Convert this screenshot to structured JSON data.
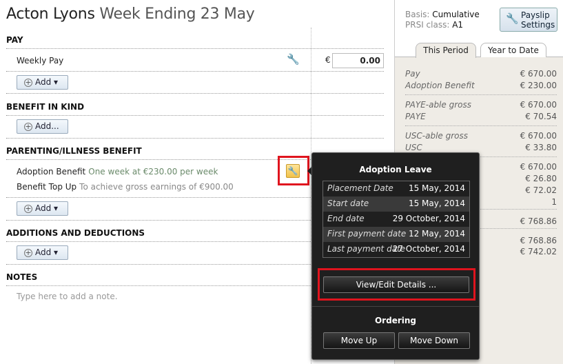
{
  "header": {
    "name": "Acton Lyons",
    "period": "Week Ending 23 May"
  },
  "pay": {
    "title": "PAY",
    "item": "Weekly Pay",
    "currency": "€",
    "value": "0.00",
    "add": "Add"
  },
  "bik": {
    "title": "BENEFIT IN KIND",
    "add": "Add..."
  },
  "parenting": {
    "title": "PARENTING/ILLNESS BENEFIT",
    "items": [
      {
        "label": "Adoption Benefit",
        "desc": "One week at €230.00 per week"
      },
      {
        "label": "Benefit Top Up",
        "desc": "To achieve gross earnings of €900.00"
      }
    ],
    "add": "Add"
  },
  "additions": {
    "title": "ADDITIONS AND DEDUCTIONS",
    "add": "Add"
  },
  "notes": {
    "title": "NOTES",
    "placeholder": "Type here to add a note."
  },
  "side": {
    "basis_label": "Basis:",
    "basis": "Cumulative",
    "prsi_label": "PRSI class:",
    "prsi": "A1",
    "settings": "Payslip Settings",
    "tabs": [
      {
        "label": "This Period",
        "active": true
      },
      {
        "label": "Year to Date",
        "active": false
      }
    ],
    "rows": [
      {
        "label": "Pay",
        "value": "€ 670.00"
      },
      {
        "label": "Adoption Benefit",
        "value": "€ 230.00"
      },
      {
        "label": "PAYE-able gross",
        "value": "€ 670.00"
      },
      {
        "label": "PAYE",
        "value": "€ 70.54"
      },
      {
        "label": "USC-able gross",
        "value": "€ 670.00"
      },
      {
        "label": "USC",
        "value": "€ 33.80"
      },
      {
        "value": "€ 670.00"
      },
      {
        "value": "€ 26.80"
      },
      {
        "value": "€ 72.02"
      },
      {
        "value": "1"
      },
      {
        "value": "€ 768.86"
      },
      {
        "value": "€ 768.86"
      },
      {
        "value": "€ 742.02"
      }
    ]
  },
  "popup": {
    "title": "Adoption Leave",
    "rows": [
      {
        "label": "Placement Date",
        "value": "15 May, 2014"
      },
      {
        "label": "Start date",
        "value": "15 May, 2014"
      },
      {
        "label": "End date",
        "value": "29 October, 2014"
      },
      {
        "label": "First payment date",
        "value": "12 May, 2014"
      },
      {
        "label": "Last payment date",
        "value": "27 October, 2014"
      }
    ],
    "view_edit": "View/Edit Details ...",
    "ordering": "Ordering",
    "move_up": "Move Up",
    "move_down": "Move Down"
  }
}
